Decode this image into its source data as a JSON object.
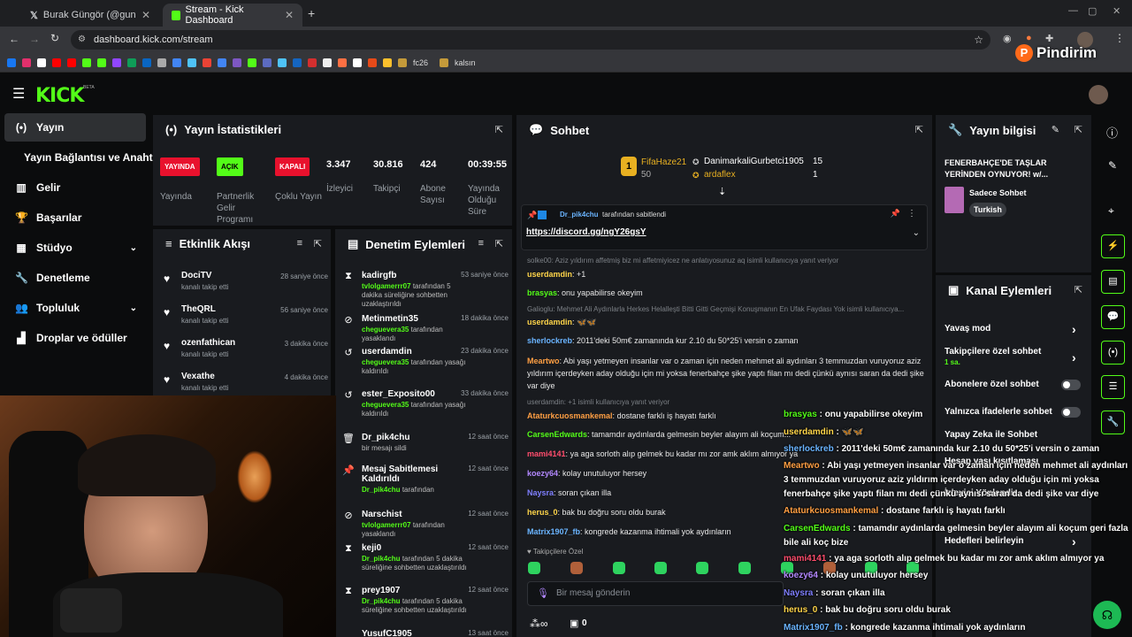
{
  "browser": {
    "tabs": [
      {
        "title": "Burak Güngör (@gungorburak)",
        "active": false
      },
      {
        "title": "Stream - Kick Dashboard",
        "active": true
      }
    ],
    "url": "dashboard.kick.com/stream",
    "bookmark_folders": [
      "fc26",
      "kalsın"
    ]
  },
  "watermark": "Pindirim",
  "header": {
    "logo": "KICK",
    "logo_beta": "BETA"
  },
  "sidebar": {
    "items": [
      {
        "label": "Yayın",
        "icon": "broadcast-icon",
        "active": true
      },
      {
        "label": "Yayın Bağlantısı ve Anahtarı",
        "icon": "",
        "active": false
      },
      {
        "label": "Gelir",
        "icon": "chart-icon",
        "active": false
      },
      {
        "label": "Başarılar",
        "icon": "trophy-icon",
        "active": false
      },
      {
        "label": "Stüdyo",
        "icon": "studio-icon",
        "active": false,
        "chevron": true
      },
      {
        "label": "Denetleme",
        "icon": "wrench-icon",
        "active": false
      },
      {
        "label": "Topluluk",
        "icon": "people-icon",
        "active": false,
        "chevron": true
      },
      {
        "label": "Droplar ve ödüller",
        "icon": "drops-icon",
        "active": false
      }
    ]
  },
  "stats": {
    "title": "Yayın İstatistikleri",
    "items": [
      {
        "badge": "YAYINDA",
        "badge_color": "#e8112d",
        "label": "Yayında"
      },
      {
        "badge": "AÇIK",
        "badge_color": "#53fc18",
        "label": "Partnerlik Gelir Programı"
      },
      {
        "badge": "KAPALI",
        "badge_color": "#e8112d",
        "label": "Çoklu Yayın"
      },
      {
        "value": "3.347",
        "label": "İzleyici"
      },
      {
        "value": "30.816",
        "label": "Takipçi"
      },
      {
        "value": "424",
        "label": "Abone Sayısı"
      },
      {
        "value": "00:39:55",
        "label": "Yayında Olduğu Süre"
      }
    ]
  },
  "activity": {
    "title": "Etkinlik Akışı",
    "items": [
      {
        "name": "DociTV",
        "sub": "kanalı takip etti",
        "time": "28 saniye önce"
      },
      {
        "name": "TheQRL",
        "sub": "kanalı takip etti",
        "time": "56 saniye önce"
      },
      {
        "name": "ozenfathican",
        "sub": "kanalı takip etti",
        "time": "3 dakika önce"
      },
      {
        "name": "Vexathe",
        "sub": "kanalı takip etti",
        "time": "4 dakika önce"
      }
    ]
  },
  "moderation": {
    "title": "Denetim Eylemleri",
    "items": [
      {
        "icon": "hourglass-icon",
        "name": "kadirgfb",
        "mod": "tvlolgamerrr07",
        "text": "tarafından 5 dakika süreliğine sohbetten uzaklaştırıldı",
        "time": "53 saniye önce"
      },
      {
        "icon": "ban-icon",
        "name": "Metinmetin35",
        "mod": "cheguevera35",
        "text": "tarafından yasaklandı",
        "time": "18 dakika önce"
      },
      {
        "icon": "undo-icon",
        "name": "userdamdin",
        "mod": "cheguevera35",
        "text": "tarafından yasağı kaldırıldı",
        "time": "23 dakika önce"
      },
      {
        "icon": "undo-icon",
        "name": "ester_Exposito00",
        "mod": "cheguevera35",
        "text": "tarafından yasağı kaldırıldı",
        "time": "33 dakika önce"
      },
      {
        "icon": "trash-icon",
        "name": "Dr_pik4chu",
        "mod": "",
        "text": "bir mesajı sildi",
        "time": "12 saat önce"
      },
      {
        "icon": "pin-icon",
        "name": "Mesaj Sabitlemesi Kaldırıldı",
        "mod": "Dr_pik4chu",
        "text": "tarafından",
        "time": "12 saat önce"
      },
      {
        "icon": "ban-icon",
        "name": "Narschist",
        "mod": "tvlolgamerrr07",
        "text": "tarafından yasaklandı",
        "time": "12 saat önce"
      },
      {
        "icon": "hourglass-icon",
        "name": "keji0",
        "mod": "Dr_pik4chu",
        "text": "tarafından 5 dakika süreliğine sohbetten uzaklaştırıldı",
        "time": "12 saat önce"
      },
      {
        "icon": "hourglass-icon",
        "name": "prey1907",
        "mod": "Dr_pik4chu",
        "text": "tarafından 5 dakika süreliğine sohbetten uzaklaştırıldı",
        "time": "12 saat önce"
      },
      {
        "icon": "",
        "name": "YusufC1905",
        "mod": "",
        "text": "",
        "time": "13 saat önce"
      }
    ]
  },
  "chat": {
    "title": "Sohbet",
    "leaders": [
      {
        "rank": "1",
        "name": "FifaHaze21",
        "value": "50"
      },
      {
        "name": "DanimarkaliGurbetci1905",
        "value": "15"
      },
      {
        "name": "ardaflex",
        "value": "1"
      }
    ],
    "pinned": {
      "by": "Dr_pik4chu",
      "label": "tarafından sabitlendi",
      "link": "https://discord.gg/ngY26gsY"
    },
    "messages": [
      {
        "reply": "solke00: Aziz yıldırım affetmiş biz mi affetmiyicez ne anlatıyosunuz aq isimli kullanıcıya yanıt veriyor"
      },
      {
        "user": "userdamdin",
        "color": "#ffd54a",
        "text": "+1"
      },
      {
        "user": "brasyas",
        "color": "#53fc18",
        "text": "onu yapabilirse okeyim"
      },
      {
        "reply": "Galioglu: Mehmet Ali Aydınlarla Herkes Helalleşti Bitti Gitti Geçmişi Konuşmanın En Ufak Faydası Yok isimli kullanıcıya..."
      },
      {
        "user": "userdamdin",
        "color": "#ffd54a",
        "text": "🦋🦋"
      },
      {
        "user": "sherlockreb",
        "color": "#6ab4ff",
        "text": "2011'deki 50m€ zamanında kur 2.10 du 50*25'i versin o zaman"
      },
      {
        "user": "Meartwo",
        "color": "#ff9f43",
        "text": "Abi yaşı yetmeyen insanlar var o zaman için neden mehmet ali aydınları 3 temmuzdan vuruyoruz aziz yıldırım içerdeyken aday olduğu için mi yoksa fenerbahçe şike yaptı filan mı dedi çünkü aynısı saran da dedi şike var diye"
      },
      {
        "reply": "userdamdin: +1 isimli kullanıcıya yanıt veriyor"
      },
      {
        "user": "Ataturkcuosmankemal",
        "color": "#ff9f43",
        "text": "dostane farklı iş hayatı farklı"
      },
      {
        "user": "CarsenEdwards",
        "color": "#53fc18",
        "text": "tamamdır aydınlarda gelmesin beyler alayım ali koçum..."
      },
      {
        "user": "mami4141",
        "color": "#ff4d6d",
        "text": "ya aga sorloth alıp gelmek bu kadar mı zor amk aklım almıyor ya"
      },
      {
        "user": "koezy64",
        "color": "#b388ff",
        "text": "kolay unutuluyor hersey"
      },
      {
        "user": "Naysra",
        "color": "#7f7fff",
        "text": "soran çıkan illa"
      },
      {
        "user": "herus_0",
        "color": "#ffd54a",
        "text": "bak bu doğru soru oldu burak"
      },
      {
        "user": "Matrix1907_fb",
        "color": "#6ab4ff",
        "text": "kongrede kazanma ihtimali yok aydınların"
      }
    ],
    "followers_only": "Takipçilere Özel",
    "input_placeholder": "Bir mesaj gönderin",
    "footer_count": "0"
  },
  "overlay": {
    "messages": [
      {
        "user": "brasyas",
        "color": "#53fc18",
        "text": "onu yapabilirse okeyim"
      },
      {
        "user": "userdamdin",
        "color": "#ffd54a",
        "text": "🦋🦋"
      },
      {
        "user": "sherlockreb",
        "color": "#6ab4ff",
        "text": "2011'deki 50m€ zamanında kur 2.10 du 50*25'i versin o zaman"
      },
      {
        "user": "Meartwo",
        "color": "#ff9f43",
        "text": "Abi yaşı yetmeyen insanlar var o zaman için neden mehmet ali aydınları 3 temmuzdan vuruyoruz aziz yıldırım içerdeyken aday olduğu için mi yoksa fenerbahçe şike yaptı filan mı dedi çünkü aynısı saran da dedi şike var diye"
      },
      {
        "user": "Ataturkcuosmankemal",
        "color": "#ff9f43",
        "text": "dostane farklı iş hayatı farklı"
      },
      {
        "user": "CarsenEdwards",
        "color": "#53fc18",
        "text": "tamamdır aydınlarda gelmesin beyler alayım ali koçum geri fazla bile ali koç bize"
      },
      {
        "user": "mami4141",
        "color": "#ff4d6d",
        "text": "ya aga sorloth alıp gelmek bu kadar mı zor amk aklım almıyor ya"
      },
      {
        "user": "koezy64",
        "color": "#b388ff",
        "text": "kolay unutuluyor hersey"
      },
      {
        "user": "Naysra",
        "color": "#7f7fff",
        "text": "soran çıkan illa"
      },
      {
        "user": "herus_0",
        "color": "#ffd54a",
        "text": "bak bu doğru soru oldu burak"
      },
      {
        "user": "Matrix1907_fb",
        "color": "#6ab4ff",
        "text": "kongrede kazanma ihtimali yok aydınların"
      }
    ]
  },
  "streaminfo": {
    "title": "Yayın bilgisi",
    "stream_title": "FENERBAHÇE'DE TAŞLAR YERİNDEN OYNUYOR! w/...",
    "category": "Sadece Sohbet",
    "tag": "Turkish"
  },
  "channel_actions": {
    "title": "Kanal Eylemleri",
    "items": [
      {
        "label": "Yavaş mod",
        "type": "chevron"
      },
      {
        "label": "Takipçilere özel sohbet",
        "sub": "1 sa.",
        "type": "chevron"
      },
      {
        "label": "Abonelere özel sohbet",
        "type": "toggle"
      },
      {
        "label": "Yalnızca ifadelerle sohbet",
        "type": "toggle"
      },
      {
        "label": "Yapay Zeka ile Sohbet"
      },
      {
        "label": "Hesap yaşı kısıtlaması"
      },
      {
        "label": "İzleyici Yönlendir"
      },
      {
        "label": "Hedefleri belirleyin",
        "type": "chevron"
      }
    ]
  },
  "colors": {
    "accent": "#53fc18",
    "live": "#e8112d",
    "panel": "#191b1f",
    "bg": "#0b0c0d"
  }
}
